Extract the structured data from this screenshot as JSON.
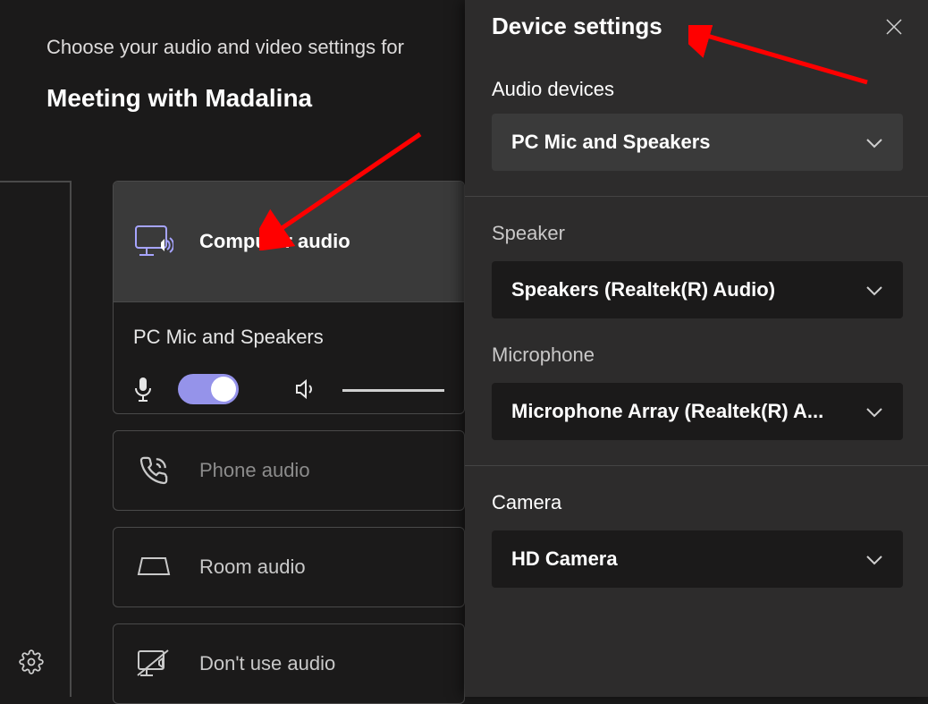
{
  "prejoin": {
    "subtitle": "Choose your audio and video settings for",
    "meeting_title": "Meeting with Madalina",
    "options": {
      "computer_audio": "Computer audio",
      "phone_audio": "Phone audio",
      "room_audio": "Room audio",
      "dont_use_audio": "Don't use audio"
    },
    "selected_device_summary": "PC Mic and Speakers"
  },
  "panel": {
    "title": "Device settings",
    "audio_devices": {
      "label": "Audio devices",
      "selected": "PC Mic and Speakers"
    },
    "speaker": {
      "label": "Speaker",
      "selected": "Speakers (Realtek(R) Audio)"
    },
    "microphone": {
      "label": "Microphone",
      "selected": "Microphone Array (Realtek(R) A..."
    },
    "camera": {
      "label": "Camera",
      "selected": "HD Camera"
    }
  }
}
